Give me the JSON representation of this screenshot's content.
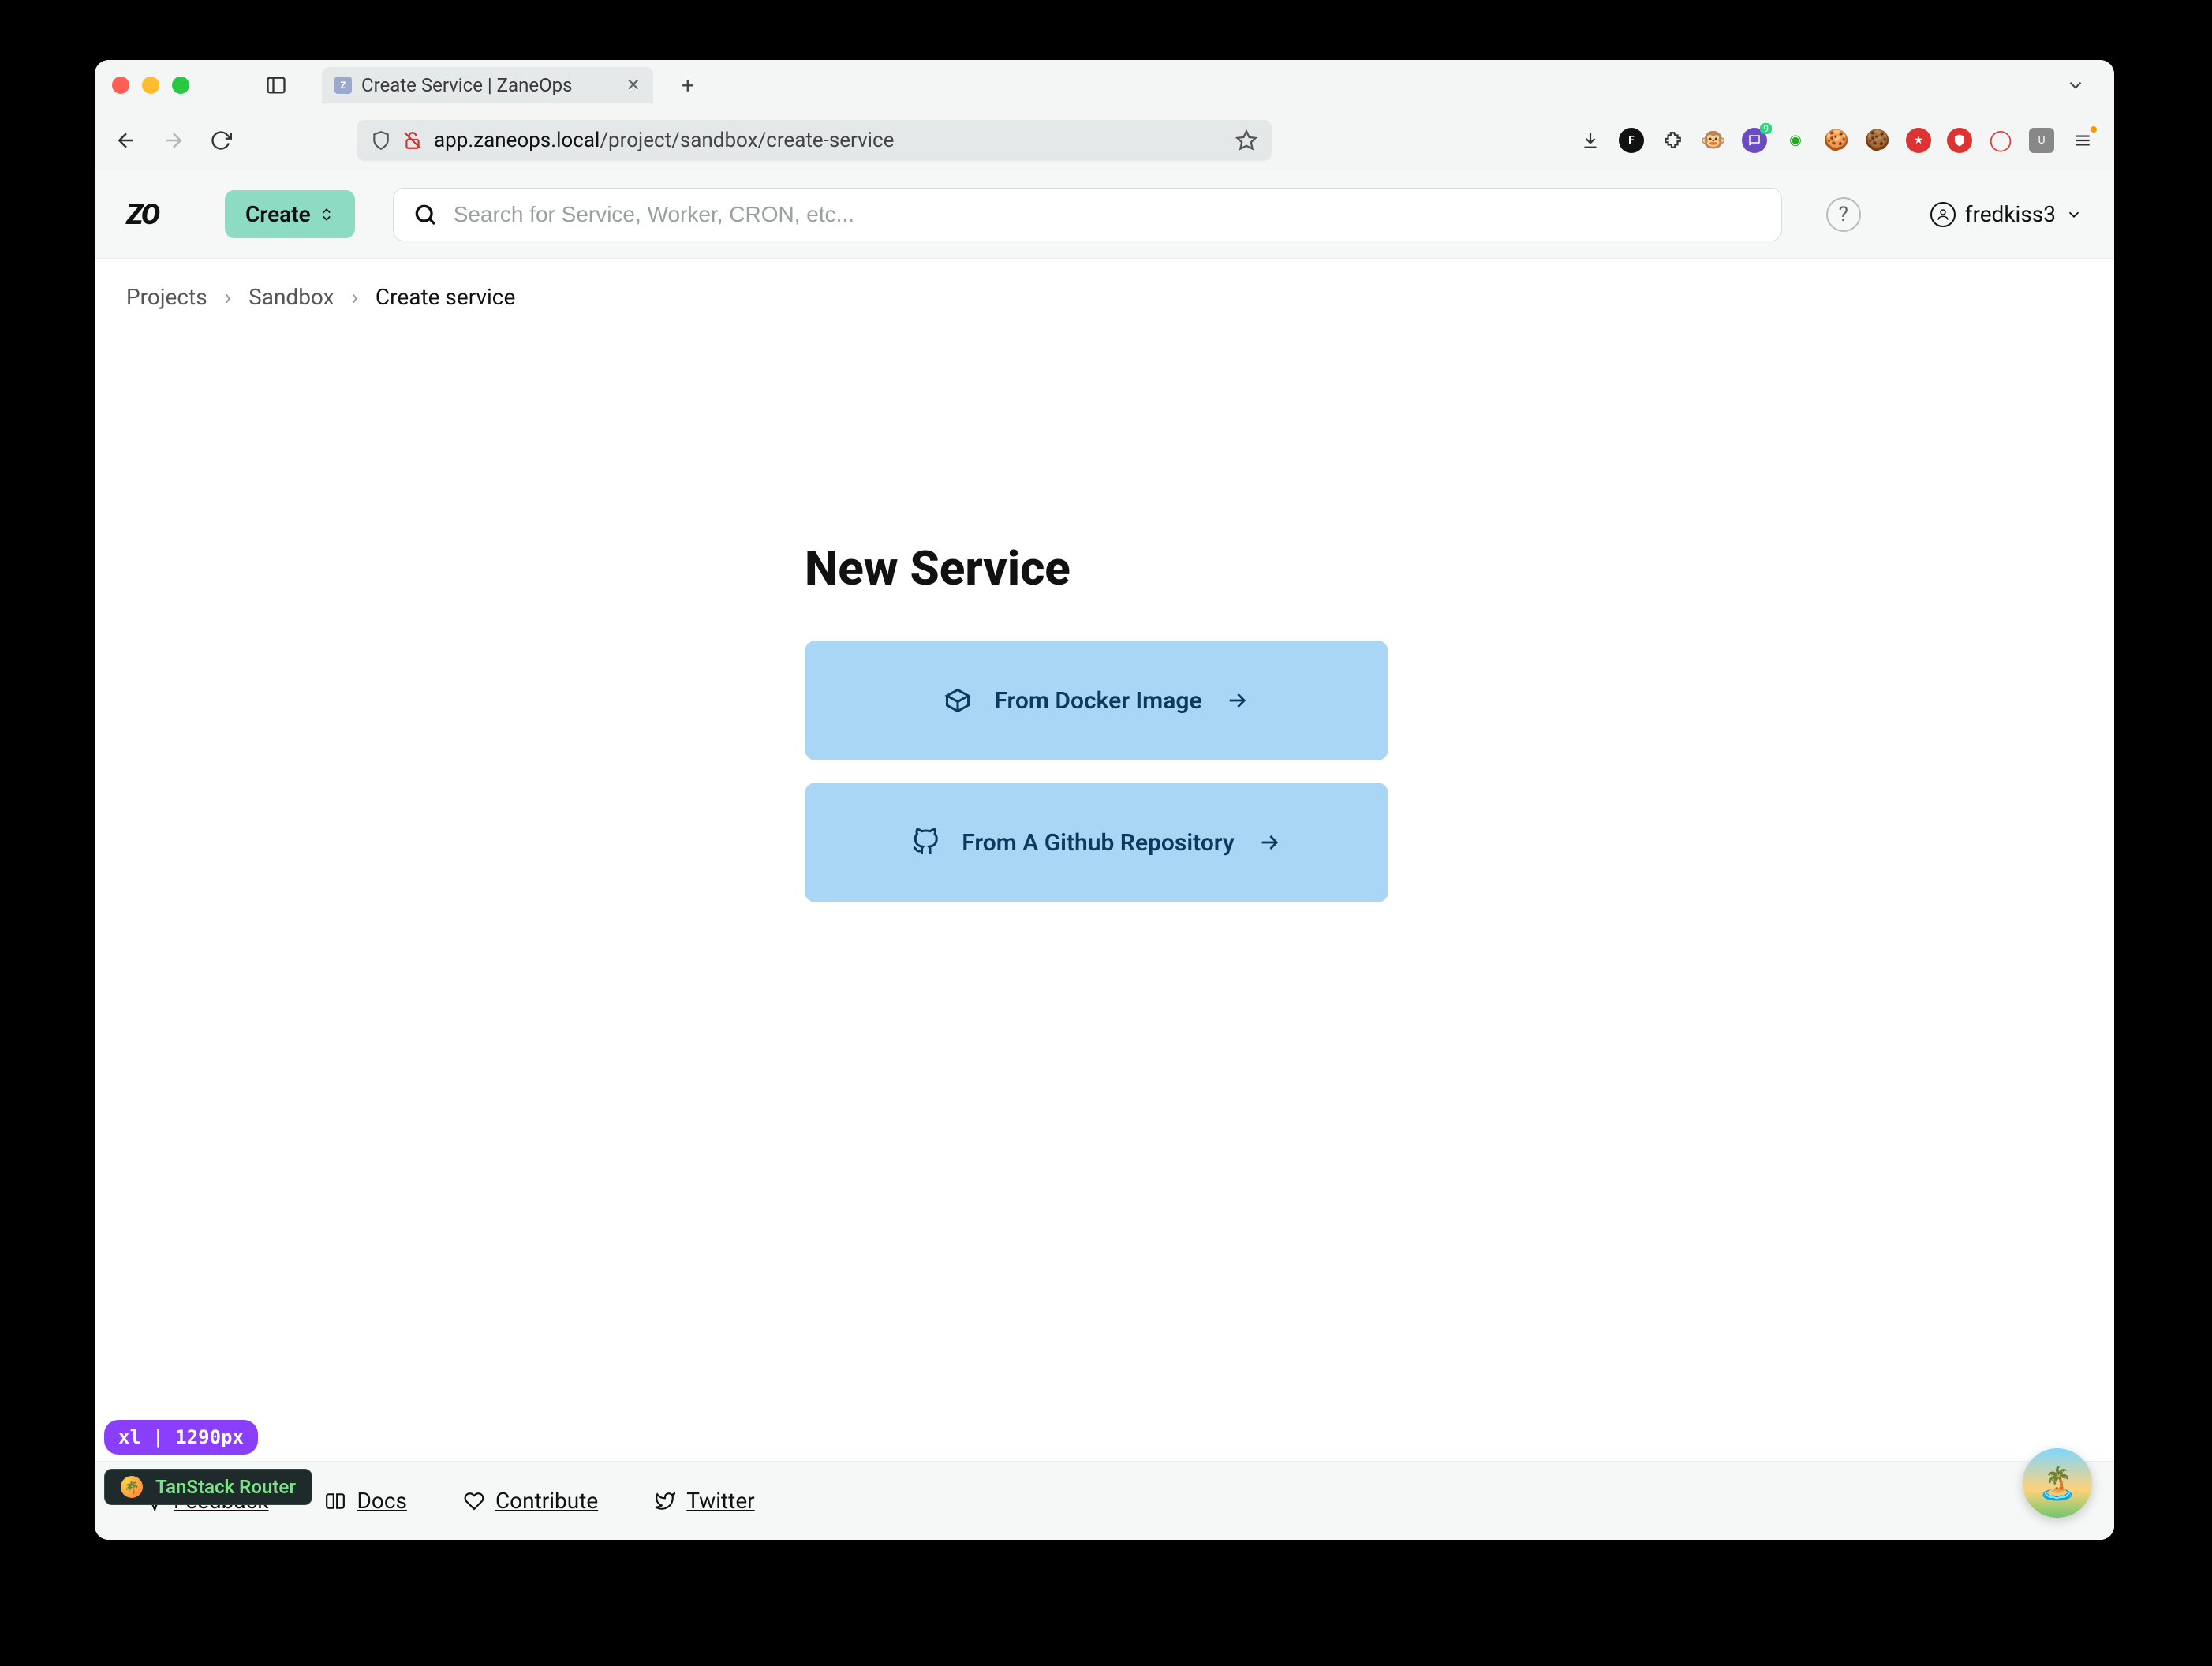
{
  "browser": {
    "tab_title": "Create Service | ZaneOps",
    "url_host": "app.zaneops.local",
    "url_path": "/project/sandbox/create-service"
  },
  "header": {
    "logo_text": "ZO",
    "create_label": "Create",
    "search_placeholder": "Search for Service, Worker, CRON, etc...",
    "username": "fredkiss3"
  },
  "breadcrumb": {
    "items": [
      {
        "label": "Projects",
        "current": false
      },
      {
        "label": "Sandbox",
        "current": false
      },
      {
        "label": "Create service",
        "current": true
      }
    ]
  },
  "main": {
    "heading": "New Service",
    "options": [
      {
        "id": "docker",
        "label": "From Docker Image"
      },
      {
        "id": "github",
        "label": "From A Github Repository"
      }
    ]
  },
  "footer": {
    "links": [
      {
        "id": "feedback",
        "label": "Feedback"
      },
      {
        "id": "docs",
        "label": "Docs"
      },
      {
        "id": "contribute",
        "label": "Contribute"
      },
      {
        "id": "twitter",
        "label": "Twitter"
      }
    ]
  },
  "overlays": {
    "breakpoint_badge": "xl | 1290px",
    "devtool_label": "TanStack Router"
  }
}
